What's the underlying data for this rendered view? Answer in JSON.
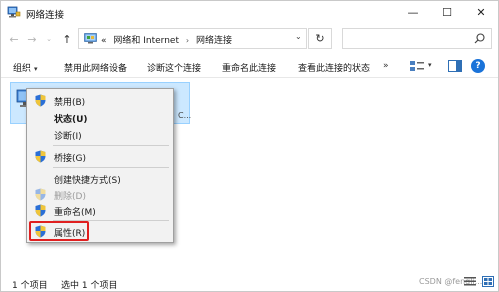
{
  "window": {
    "title": "网络连接",
    "controls": {
      "minimize": "—",
      "maximize": "☐",
      "close": "✕"
    }
  },
  "nav": {
    "back": "←",
    "forward": "→",
    "recent": "⌄",
    "up": "↑",
    "refresh": "↻",
    "dropdown": "⌄",
    "breadcrumb": {
      "overflow": "«",
      "parent": "网络和 Internet",
      "separator": "›",
      "current": "网络连接"
    },
    "search_placeholder": ""
  },
  "commandbar": {
    "organize": "组织",
    "organize_caret": "▾",
    "disable_device": "禁用此网络设备",
    "diagnose": "诊断这个连接",
    "rename": "重命名此连接",
    "view_status": "查看此连接的状态",
    "more": "»",
    "view_caret": "▾",
    "help": "?"
  },
  "content": {
    "item_truncated_text": "C..."
  },
  "context_menu": {
    "items": [
      {
        "label": "禁用(B)",
        "shield": true,
        "bold": false,
        "disabled": false
      },
      {
        "label": "状态(U)",
        "shield": false,
        "bold": true,
        "disabled": false
      },
      {
        "label": "诊断(I)",
        "shield": false,
        "bold": false,
        "disabled": false
      },
      {
        "label": "桥接(G)",
        "shield": true,
        "bold": false,
        "disabled": false
      },
      {
        "label": "创建快捷方式(S)",
        "shield": false,
        "bold": false,
        "disabled": false
      },
      {
        "label": "删除(D)",
        "shield": true,
        "bold": false,
        "disabled": true
      },
      {
        "label": "重命名(M)",
        "shield": true,
        "bold": false,
        "disabled": false
      },
      {
        "label": "属性(R)",
        "shield": true,
        "bold": false,
        "disabled": false
      }
    ],
    "highlighted_item": "属性(R)",
    "highlight_color": "#e02020"
  },
  "statusbar": {
    "item_count": "1 个项目",
    "selected_count": "选中 1 个项目",
    "watermark": "CSDN @fengli..."
  },
  "colors": {
    "selection_bg": "#cce8ff",
    "selection_border": "#99d1ff",
    "menu_bg": "#f2f2f2",
    "accent_blue": "#1a73d9"
  },
  "icons": {
    "title": "network-connections-icon",
    "address": "control-panel-icon",
    "search": "search-icon",
    "view": "change-view-icon",
    "pane": "preview-pane-icon",
    "help": "help-icon",
    "item": "network-adapter-icon",
    "shield": "uac-shield-icon",
    "details": "details-view-icon",
    "tiles": "large-icons-view-icon"
  }
}
